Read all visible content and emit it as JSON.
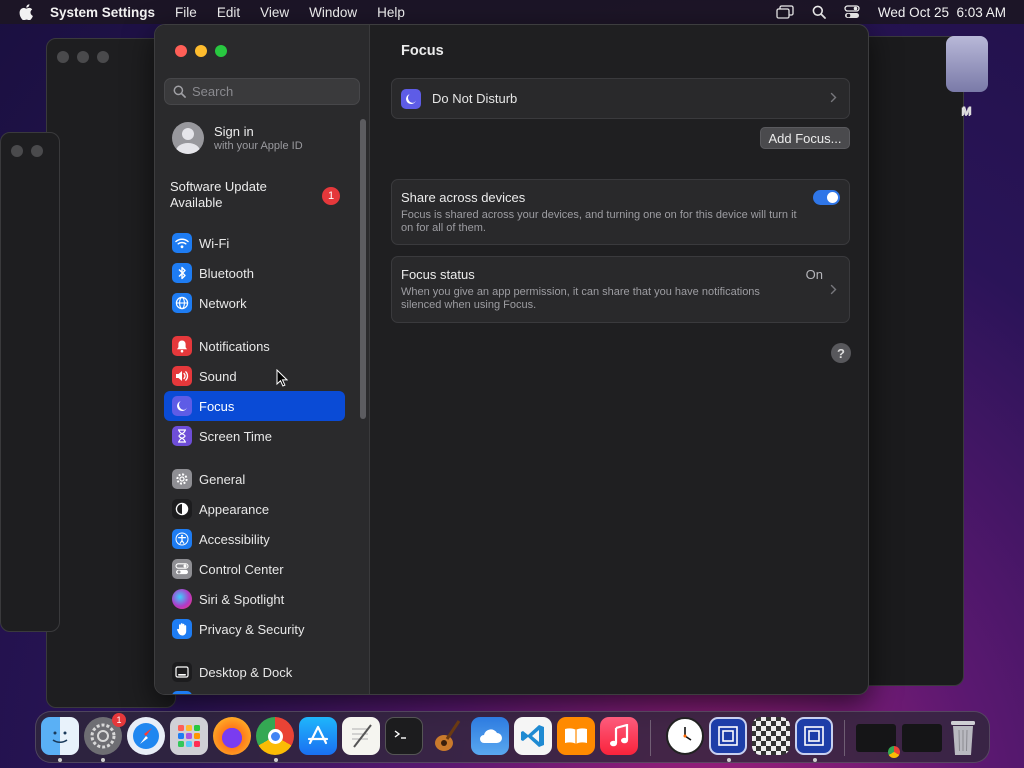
{
  "menubar": {
    "app_name": "System Settings",
    "menus": [
      "File",
      "Edit",
      "View",
      "Window",
      "Help"
    ],
    "datetime": "Wed Oct 25  6:03 AM"
  },
  "background": {
    "partial_label": "M"
  },
  "sidebar": {
    "search_placeholder": "Search",
    "signin_title": "Sign in",
    "signin_subtitle": "with your Apple ID",
    "update_label": "Software Update Available",
    "update_badge": "1",
    "items": [
      {
        "label": "Wi-Fi",
        "icon": "wifi-icon",
        "color": "#1e7cf2"
      },
      {
        "label": "Bluetooth",
        "icon": "bluetooth-icon",
        "color": "#1e7cf2"
      },
      {
        "label": "Network",
        "icon": "globe-icon",
        "color": "#1e7cf2"
      },
      {
        "label": "Notifications",
        "icon": "bell-icon",
        "color": "#e5383b"
      },
      {
        "label": "Sound",
        "icon": "speaker-icon",
        "color": "#e5383b"
      },
      {
        "label": "Focus",
        "icon": "moon-icon",
        "color": "#5e5ce6",
        "selected": true
      },
      {
        "label": "Screen Time",
        "icon": "hourglass-icon",
        "color": "#6e4ed8"
      },
      {
        "label": "General",
        "icon": "gear-icon",
        "color": "#8e8e93"
      },
      {
        "label": "Appearance",
        "icon": "appearance-icon",
        "color": "#1c1c1e"
      },
      {
        "label": "Accessibility",
        "icon": "accessibility-icon",
        "color": "#1e7cf2"
      },
      {
        "label": "Control Center",
        "icon": "control-center-icon",
        "color": "#8e8e93"
      },
      {
        "label": "Siri & Spotlight",
        "icon": "siri-icon",
        "color": "#b03ac8"
      },
      {
        "label": "Privacy & Security",
        "icon": "hand-icon",
        "color": "#1e7cf2"
      },
      {
        "label": "Desktop & Dock",
        "icon": "desktop-icon",
        "color": "#1c1c1e"
      }
    ]
  },
  "content": {
    "title": "Focus",
    "dnd_label": "Do Not Disturb",
    "add_focus_label": "Add Focus...",
    "share_title": "Share across devices",
    "share_desc": "Focus is shared across your devices, and turning one on for this device will turn it on for all of them.",
    "share_enabled": true,
    "status_title": "Focus status",
    "status_desc": "When you give an app permission, it can share that you have notifications silenced when using Focus.",
    "status_value": "On",
    "help_label": "?"
  },
  "dock": {
    "settings_badge": "1",
    "apps": [
      "finder",
      "system-settings",
      "safari",
      "launchpad",
      "firefox",
      "chrome",
      "app-store",
      "textedit",
      "terminal",
      "garageband",
      "weather",
      "vscode",
      "books",
      "music",
      "clock",
      "remote-desktop",
      "chess",
      "remote-desktop-2"
    ]
  },
  "colors": {
    "accent": "#0a4bd6",
    "toggle_on": "#2f76e8",
    "badge": "#e5383b"
  }
}
